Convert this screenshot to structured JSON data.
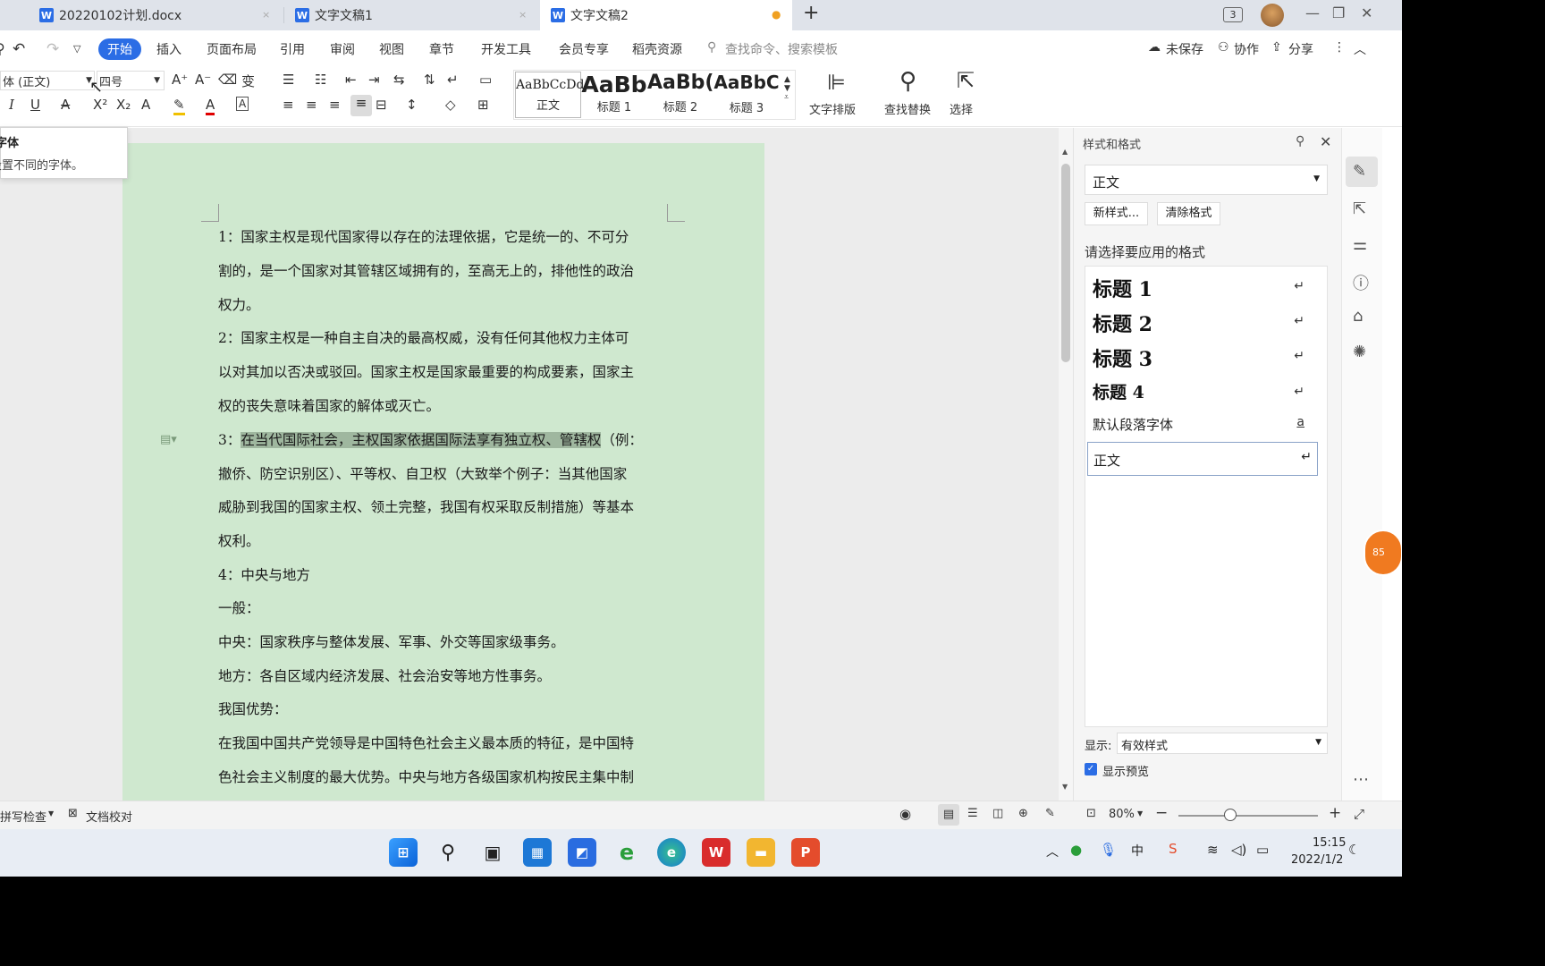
{
  "tabs": [
    {
      "label": "20220102计划.docx",
      "close": "×"
    },
    {
      "label": "文字文稿1",
      "close": "×"
    },
    {
      "label": "文字文稿2",
      "close": "●"
    }
  ],
  "tab_add": "+",
  "tab_count": "3",
  "menu": {
    "start": "开始",
    "items": [
      "插入",
      "页面布局",
      "引用",
      "审阅",
      "视图",
      "章节",
      "开发工具",
      "会员专享",
      "稻壳资源"
    ],
    "search_placeholder": "查找命令、搜索模板",
    "unsaved": "未保存",
    "collab": "协作",
    "share": "分享"
  },
  "ribbon": {
    "font_name": "体 (正文)",
    "font_size": "四号",
    "styles": [
      {
        "preview": "AaBbCcDd",
        "label": "正文"
      },
      {
        "preview": "AaBb",
        "label": "标题 1"
      },
      {
        "preview": "AaBb(",
        "label": "标题 2"
      },
      {
        "preview": "AaBbC",
        "label": "标题 3"
      }
    ],
    "text_layout": "文字排版",
    "find_replace": "查找替换",
    "select": "选择"
  },
  "tooltip": {
    "title": "字体",
    "desc": "设置不同的字体。"
  },
  "document": {
    "lines": [
      "1：国家主权是现代国家得以存在的法理依据，它是统一的、不可分",
      "割的，是一个国家对其管辖区域拥有的，至高无上的，排他性的政治",
      "权力。",
      "2：国家主权是一种自主自决的最高权威，没有任何其他权力主体可",
      "以对其加以否决或驳回。国家主权是国家最重要的构成要素，国家主",
      "权的丧失意味着国家的解体或灭亡。",
      "撤侨、防空识别区）、平等权、自卫权（大致举个例子：当其他国家",
      "威胁到我国的国家主权、领土完整，我国有权采取反制措施）等基本",
      "权利。",
      "4：中央与地方",
      "一般：",
      "中央：国家秩序与整体发展、军事、外交等国家级事务。",
      "地方：各自区域内经济发展、社会治安等地方性事务。",
      "我国优势：",
      "在我国中国共产党领导是中国特色社会主义最本质的特征，是中国特",
      "色社会主义制度的最大优势。中央与地方各级国家机构按民主集中制"
    ],
    "line3_prefix": "3：",
    "line3_highlight": "在当代国际社会，主权国家依据国际法享有独立权、管辖权",
    "line3_suffix": "（例："
  },
  "panel": {
    "title": "样式和格式",
    "current": "正文",
    "new_style": "新样式...",
    "clear_format": "清除格式",
    "prompt": "请选择要应用的格式",
    "items": [
      "标题 1",
      "标题 2",
      "标题 3",
      "标题 4"
    ],
    "default_font": "默认段落字体",
    "default_font_mark": "a",
    "body": "正文",
    "show_label": "显示:",
    "show_value": "有效样式",
    "preview": "显示预览"
  },
  "status": {
    "spell": "拼写检查",
    "proof": "文档校对",
    "zoom": "80%"
  },
  "clock": {
    "time": "15:15",
    "date": "2022/1/2"
  },
  "badge": "85",
  "colors": {
    "accent": "#2b6de5",
    "page": "#cfe8cf",
    "highlight": "#9fb79f"
  }
}
